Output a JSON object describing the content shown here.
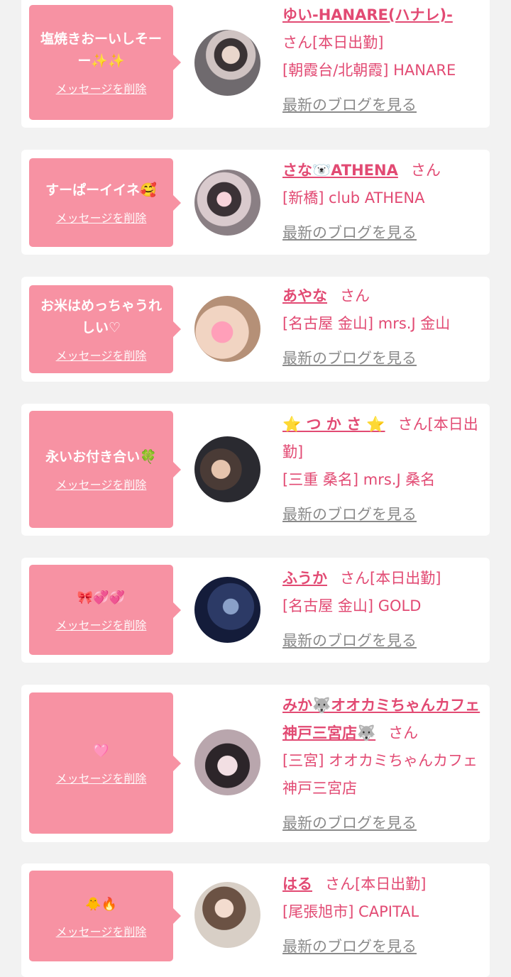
{
  "delete_label": "メッセージを削除",
  "blog_label": "最新のブログを見る",
  "colors": {
    "accent": "#e24a73",
    "bubble": "#f792a3",
    "link_gray": "#8a8a8a",
    "bg": "#f2f2f2"
  },
  "items": [
    {
      "message": "塩焼きおーいしそーー✨✨",
      "name": "ゆい-HANARE(ハナレ)-",
      "suffix": "さん[本日出勤]",
      "shop": "[朝霞台/北朝霞] HANARE"
    },
    {
      "message": "すーぱーイイネ🥰",
      "name": "さな🐻‍❄️ATHENA",
      "suffix": "さん",
      "shop": "[新橋] club ATHENA"
    },
    {
      "message": "お米はめっちゃうれしい♡",
      "name": "あやな",
      "suffix": "さん",
      "shop": "[名古屋 金山] mrs.J 金山"
    },
    {
      "message": "永いお付き合い🍀",
      "name": "⭐ つ か さ ⭐",
      "suffix": "さん[本日出勤]",
      "shop": "[三重 桑名] mrs.J 桑名"
    },
    {
      "message": "🎀💞💞",
      "name": "ふうか",
      "suffix": "さん[本日出勤]",
      "shop": "[名古屋 金山] GOLD"
    },
    {
      "message": "🩷",
      "name": "みか🐺オオカミちゃんカフェ神戸三宮店🐺",
      "suffix": "さん",
      "shop": "[三宮] オオカミちゃんカフェ神戸三宮店"
    },
    {
      "message": "🐥🔥",
      "name": "はる",
      "suffix": "さん[本日出勤]",
      "shop": "[尾張旭市] CAPITAL"
    }
  ]
}
